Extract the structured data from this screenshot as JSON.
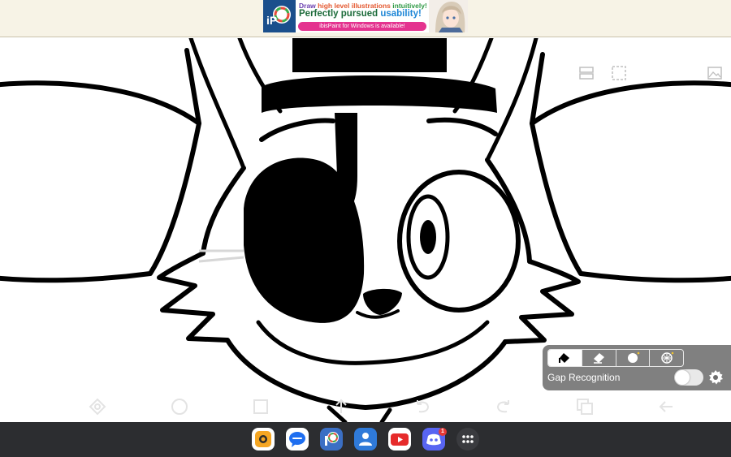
{
  "ad": {
    "line1_a": "Draw ",
    "line1_b": "high level illustrations",
    "line1_c": " intuitively!",
    "line2_a": "Perfectly pursued ",
    "line2_b": "usability!",
    "line3": "ibisPaint for Windows is available!",
    "logo_text": "iP"
  },
  "canvas": {
    "top_icons": [
      "reference-window-icon",
      "selection-icon",
      "layer-thumbnail-icon"
    ],
    "ghost_toolbar": [
      "transform-icon",
      "brush-circle-icon",
      "layer-icon",
      "undo-icon",
      "redo-icon",
      "copy-icon",
      "back-arrow-icon"
    ]
  },
  "fill_tool_panel": {
    "modes": [
      "fill-bucket-mode",
      "eraser-fill-mode",
      "lasso-fill-mode",
      "pattern-fill-mode"
    ],
    "selected_mode": "fill-bucket-mode",
    "gap_recognition_label": "Gap Recognition",
    "gap_recognition_enabled": false
  },
  "taskbar": {
    "apps": [
      "camera-app",
      "messages-app",
      "ibispaint-app",
      "contacts-app",
      "youtube-app",
      "discord-app",
      "app-drawer"
    ],
    "discord_badge": "1",
    "colors": {
      "camera": "#f5a623",
      "messages": "#1e6ef0",
      "ibispaint": "#3b6fc4",
      "contacts": "#2f7ad9",
      "youtube": "#e62b2b",
      "discord": "#5865f2"
    }
  }
}
